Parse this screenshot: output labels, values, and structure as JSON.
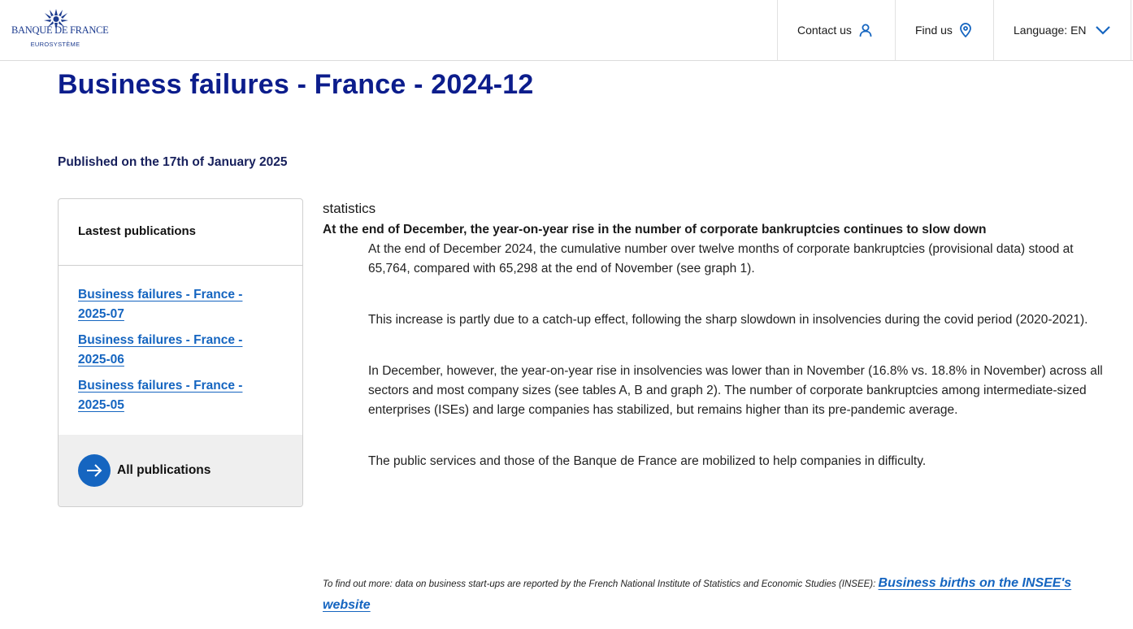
{
  "header": {
    "logo": {
      "brand": "BANQUE DE FRANCE",
      "sub": "EUROSYSTÈME",
      "icon": "bdf-emblem-icon"
    },
    "nav": {
      "contact_label": "Contact us",
      "contact_icon": "user-icon",
      "find_label": "Find us",
      "find_icon": "location-pin-icon",
      "language_label": "Language: EN",
      "language_icon": "chevron-down-icon"
    }
  },
  "page": {
    "title": "Business failures - France - 2024-12",
    "published": "Published on the 17th of January 2025"
  },
  "sidebar": {
    "heading": "Lastest publications",
    "links": [
      {
        "label": "Business failures - France - 2025-07"
      },
      {
        "label": "Business failures - France - 2025-06"
      },
      {
        "label": "Business failures - France - 2025-05"
      }
    ],
    "all_label": "All publications",
    "all_icon": "arrow-right-icon"
  },
  "article": {
    "category": "statistics",
    "headline": "At the end of December, the year-on-year rise in the number of corporate bankruptcies continues to slow down",
    "paragraphs": [
      "At the end of December 2024, the cumulative number over twelve months of corporate bankruptcies (provisional data) stood at 65,764, compared with 65,298 at the end of November (see graph 1).",
      "This increase is partly due to a catch-up effect, following the sharp slowdown in insolvencies during the covid period (2020-2021).",
      "In December, however, the year-on-year rise in insolvencies was lower than in November (16.8% vs. 18.8% in November) across all sectors and most company sizes (see tables A, B and graph 2). The number of corporate bankruptcies among intermediate-sized enterprises (ISEs) and large companies has stabilized, but remains higher than its pre-pandemic average.",
      "The public services and those of the Banque de France are mobilized to help companies in difficulty."
    ],
    "footnote": "To find out more: data on business start-ups are reported by the French National Institute of Statistics and Economic Studies (INSEE): ",
    "footnote_link": "Business births on the INSEE's website"
  },
  "colors": {
    "title": "#0c1d8c",
    "link": "#1565c0",
    "brand": "#1d3c8f"
  }
}
